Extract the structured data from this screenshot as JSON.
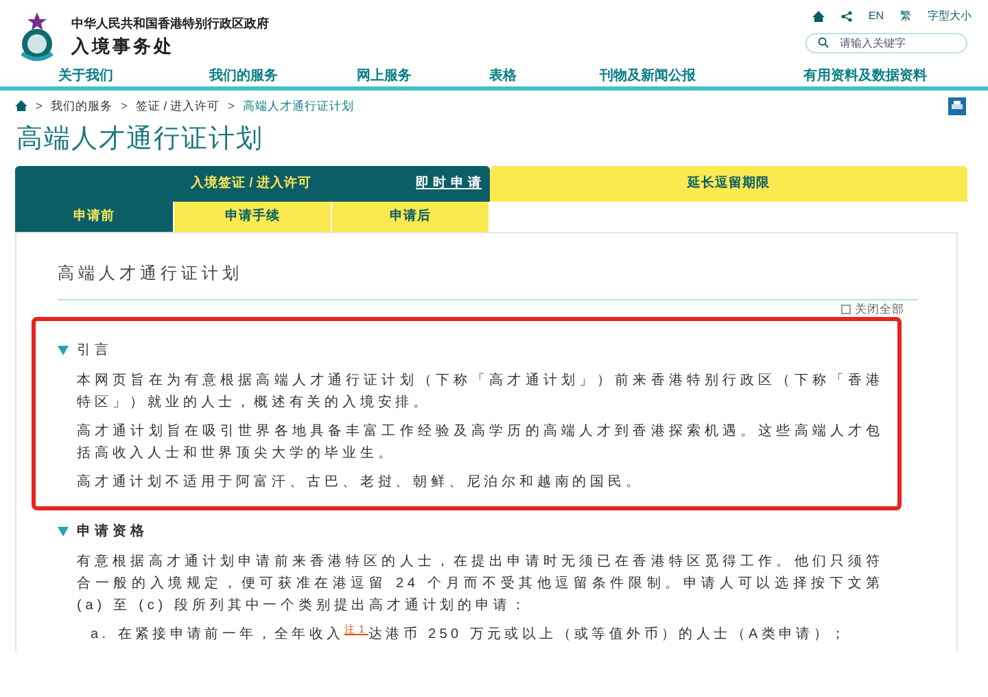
{
  "header": {
    "agency_parent": "中华人民共和国香港特别行政区政府",
    "agency_name": "入境事务处",
    "utility_links": [
      {
        "kind": "home"
      },
      {
        "kind": "share"
      },
      {
        "kind": "text",
        "label": "EN"
      },
      {
        "kind": "text",
        "label": "繁"
      },
      {
        "kind": "text",
        "label": "字型大小"
      }
    ],
    "search": {
      "placeholder": "请输入关键字"
    }
  },
  "nav": [
    {
      "label": "关于我们"
    },
    {
      "label": "我们的服务"
    },
    {
      "label": "网上服务"
    },
    {
      "label": "表格"
    },
    {
      "label": "刊物及新闻公报"
    },
    {
      "label": "有用资料及数据资料"
    }
  ],
  "breadcrumb": [
    {
      "separator": ">",
      "label": "我们的服务"
    },
    {
      "separator": ">",
      "label": "签证 / 进入许可"
    },
    {
      "separator": ">",
      "label": "高端人才通行证计划"
    }
  ],
  "page_title": "高端人才通行证计划",
  "main_tabs": [
    {
      "label": "入境签证 / 进入许可",
      "selected": true,
      "link": "即 时 申 请"
    },
    {
      "label": "延长逗留期限",
      "selected": false
    }
  ],
  "sub_tabs": [
    {
      "label": "申请前",
      "selected": true
    },
    {
      "label": "申请手续",
      "selected": false
    },
    {
      "label": "申请后",
      "selected": false
    }
  ],
  "card": {
    "title": "高端人才通行证计划",
    "toggle_all": {
      "label": "关闭全部",
      "checked": false
    },
    "sections": [
      {
        "title": "引言",
        "expanded": true,
        "highlighted": true,
        "paragraphs": [
          "本网页旨在为有意根据高端人才通行证计划（下称「高才通计划」）前来香港特别行政区（下称「香港特区」）就业的人士，概述有关的入境安排。",
          "高才通计划旨在吸引世界各地具备丰富工作经验及高学历的高端人才到香港探索机遇。这些高端人才包括高收入人士和世界顶尖大学的毕业生。",
          "高才通计划不适用于阿富汗、古巴、老挝、朝鲜、尼泊尔和越南的国民。"
        ]
      },
      {
        "title": "申请资格",
        "expanded": true,
        "highlighted": false,
        "paragraphs": [
          "有意根据高才通计划申请前来香港特区的人士，在提出申请时无须已在香港特区觅得工作。他们只须符合一般的入境规定，便可获准在港逗留 24 个月而不受其他逗留条件限制。申请人可以选择按下文第 (a) 至 (c) 段所列其中一个类别提出高才通计划的申请："
        ],
        "list_items": [
          {
            "marker": "a.",
            "text": "在紧接申请前一年，全年收入$^{注1}$达港币 250 万元或以上（或等值外币）的人士（A类申请）；"
          }
        ]
      }
    ]
  }
}
